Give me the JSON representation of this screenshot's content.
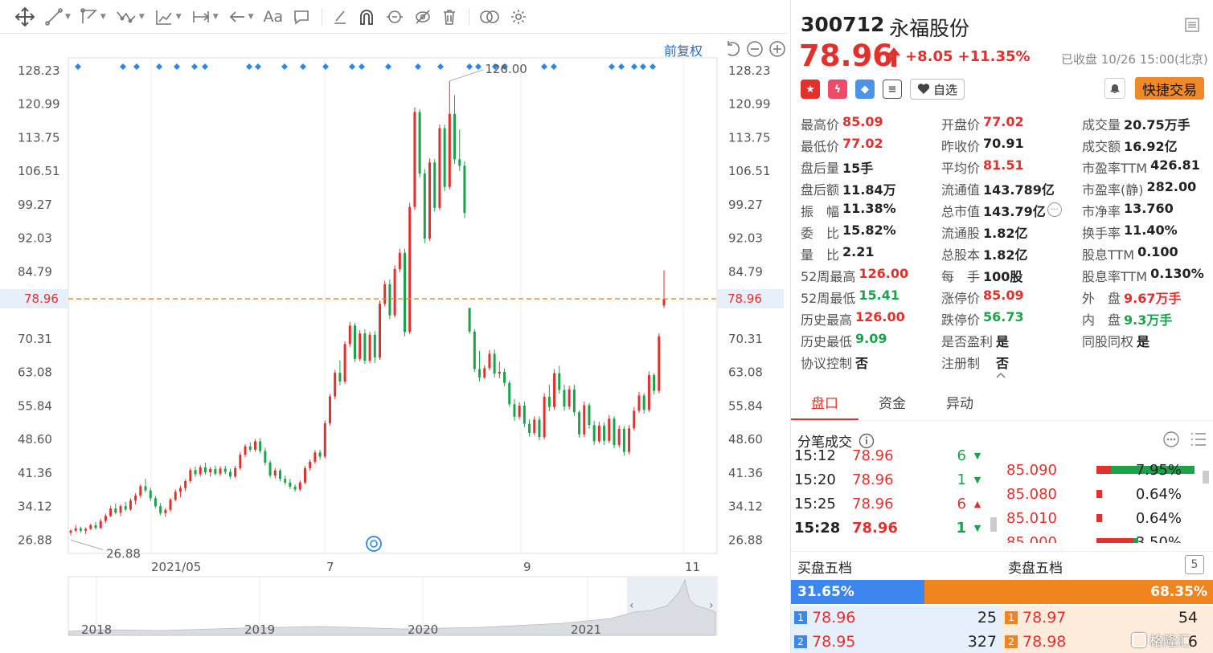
{
  "toolbar": {
    "tools": [
      "move-icon",
      "line-icon",
      "polyline-icon",
      "wave-icon",
      "measure-icon",
      "range-icon",
      "back-arrow-icon",
      "text-tool-icon",
      "comment-icon",
      "pen-icon",
      "magnet-icon",
      "lock-icon",
      "hide-icon",
      "delete-icon",
      "compare-icon",
      "settings-icon"
    ],
    "text_tool_label": "Aa"
  },
  "chart": {
    "fuquan_label": "前复权",
    "current_price_label": "78.96",
    "annotations": {
      "high": "126.00",
      "low": "26.88"
    }
  },
  "chart_data": {
    "type": "candlestick",
    "title": "",
    "xlabel": "",
    "ylabel": "",
    "y_ticks": [
      "128.23",
      "120.99",
      "113.75",
      "106.51",
      "99.27",
      "92.03",
      "84.79",
      "70.31",
      "63.08",
      "55.84",
      "48.60",
      "41.36",
      "34.12",
      "26.88"
    ],
    "x_ticks": [
      "2021/05",
      "7",
      "9",
      "11"
    ],
    "ylim": [
      24.0,
      131.0
    ],
    "current_price": 78.96,
    "high_marker": 126.0,
    "low_marker": 26.88,
    "overview_x_ticks": [
      "2018",
      "2019",
      "2020",
      "2021"
    ],
    "candles": [
      [
        28.5,
        29.2,
        27.9,
        28.9
      ],
      [
        28.9,
        30.1,
        28.6,
        29.4
      ],
      [
        29.4,
        29.8,
        28.5,
        28.9
      ],
      [
        28.9,
        29.6,
        28.2,
        29.3
      ],
      [
        29.3,
        30.4,
        29.0,
        30.1
      ],
      [
        30.1,
        30.8,
        29.1,
        29.5
      ],
      [
        29.5,
        31.5,
        29.3,
        31.0
      ],
      [
        31.0,
        32.6,
        30.5,
        32.1
      ],
      [
        32.1,
        34.3,
        31.8,
        33.7
      ],
      [
        33.7,
        34.8,
        32.4,
        32.8
      ],
      [
        32.8,
        34.6,
        32.0,
        34.2
      ],
      [
        34.2,
        35.1,
        33.1,
        33.5
      ],
      [
        33.5,
        35.9,
        33.2,
        35.4
      ],
      [
        35.4,
        37.0,
        34.6,
        36.5
      ],
      [
        36.5,
        38.9,
        36.0,
        38.5
      ],
      [
        38.5,
        40.1,
        37.2,
        37.6
      ],
      [
        37.6,
        38.2,
        35.3,
        35.9
      ],
      [
        35.9,
        36.4,
        33.8,
        34.2
      ],
      [
        34.2,
        34.9,
        32.2,
        32.7
      ],
      [
        32.7,
        33.8,
        31.9,
        33.4
      ],
      [
        33.4,
        36.0,
        33.0,
        35.6
      ],
      [
        35.6,
        37.8,
        35.2,
        37.3
      ],
      [
        37.3,
        38.6,
        36.1,
        38.1
      ],
      [
        38.1,
        40.0,
        37.5,
        39.6
      ],
      [
        39.6,
        42.4,
        39.2,
        42.0
      ],
      [
        42.0,
        42.8,
        40.5,
        41.1
      ],
      [
        41.1,
        43.1,
        40.6,
        42.6
      ],
      [
        42.6,
        43.6,
        41.0,
        41.5
      ],
      [
        41.5,
        42.7,
        40.6,
        42.2
      ],
      [
        42.2,
        43.0,
        40.8,
        41.2
      ],
      [
        41.2,
        42.8,
        40.7,
        42.3
      ],
      [
        42.3,
        42.9,
        41.1,
        41.6
      ],
      [
        41.6,
        42.3,
        40.1,
        40.6
      ],
      [
        40.6,
        42.9,
        40.2,
        42.4
      ],
      [
        42.4,
        45.9,
        42.0,
        45.3
      ],
      [
        45.3,
        47.6,
        44.8,
        47.1
      ],
      [
        47.1,
        48.0,
        45.9,
        46.4
      ],
      [
        46.4,
        48.7,
        45.9,
        48.2
      ],
      [
        48.2,
        48.9,
        45.6,
        46.1
      ],
      [
        46.1,
        46.8,
        43.0,
        43.6
      ],
      [
        43.6,
        44.1,
        40.3,
        40.8
      ],
      [
        40.8,
        42.4,
        40.2,
        41.9
      ],
      [
        41.9,
        42.3,
        39.6,
        40.1
      ],
      [
        40.1,
        40.8,
        38.8,
        39.3
      ],
      [
        39.3,
        40.1,
        37.9,
        38.4
      ],
      [
        38.4,
        38.9,
        37.3,
        37.8
      ],
      [
        37.8,
        39.8,
        37.4,
        39.3
      ],
      [
        39.3,
        42.9,
        38.9,
        42.4
      ],
      [
        42.4,
        44.3,
        41.8,
        43.8
      ],
      [
        43.8,
        46.3,
        43.3,
        45.8
      ],
      [
        45.8,
        46.4,
        44.2,
        44.9
      ],
      [
        44.9,
        52.7,
        44.5,
        52.1
      ],
      [
        52.1,
        58.4,
        51.6,
        57.9
      ],
      [
        57.9,
        63.6,
        57.3,
        63.0
      ],
      [
        63.0,
        65.7,
        60.3,
        61.1
      ],
      [
        61.1,
        69.8,
        60.6,
        69.2
      ],
      [
        69.2,
        74.0,
        68.5,
        73.2
      ],
      [
        73.2,
        73.8,
        65.3,
        66.0
      ],
      [
        66.0,
        72.2,
        65.5,
        71.5
      ],
      [
        71.5,
        72.4,
        64.9,
        65.6
      ],
      [
        65.6,
        71.9,
        65.1,
        71.2
      ],
      [
        71.2,
        72.0,
        65.1,
        66.3
      ],
      [
        66.3,
        78.6,
        65.8,
        77.9
      ],
      [
        77.9,
        82.9,
        77.4,
        82.1
      ],
      [
        82.1,
        83.1,
        74.6,
        75.4
      ],
      [
        75.4,
        86.2,
        74.9,
        85.4
      ],
      [
        85.4,
        89.8,
        84.7,
        88.9
      ],
      [
        88.9,
        89.8,
        70.9,
        71.8
      ],
      [
        71.8,
        99.7,
        71.3,
        98.8
      ],
      [
        98.8,
        120.3,
        98.2,
        119.3
      ],
      [
        119.3,
        119.9,
        105.2,
        106.0
      ],
      [
        106.0,
        107.0,
        91.0,
        92.0
      ],
      [
        92.0,
        109.3,
        91.5,
        108.4
      ],
      [
        108.4,
        109.1,
        97.8,
        98.6
      ],
      [
        98.6,
        116.6,
        98.1,
        115.8
      ],
      [
        115.8,
        116.6,
        102.2,
        103.1
      ],
      [
        103.1,
        126.0,
        102.6,
        118.9
      ],
      [
        118.9,
        122.9,
        108.1,
        109.1
      ],
      [
        109.1,
        115.5,
        106.6,
        107.7
      ],
      [
        107.7,
        108.7,
        96.4,
        97.5
      ],
      [
        77.0,
        72.0,
        71.4,
        71.9
      ],
      [
        71.9,
        72.4,
        63.2,
        63.8
      ],
      [
        63.8,
        67.7,
        61.1,
        62.0
      ],
      [
        62.0,
        64.6,
        61.6,
        64.0
      ],
      [
        64.0,
        67.9,
        63.5,
        67.1
      ],
      [
        67.1,
        68.0,
        62.0,
        62.8
      ],
      [
        62.8,
        65.4,
        61.8,
        63.2
      ],
      [
        63.2,
        63.9,
        60.1,
        60.8
      ],
      [
        60.8,
        61.3,
        55.6,
        56.2
      ],
      [
        56.2,
        57.3,
        52.6,
        53.5
      ],
      [
        53.5,
        56.6,
        52.9,
        55.9
      ],
      [
        55.9,
        56.8,
        51.2,
        52.0
      ],
      [
        52.0,
        52.9,
        49.2,
        50.0
      ],
      [
        50.0,
        53.6,
        49.5,
        52.9
      ],
      [
        52.9,
        53.6,
        48.4,
        49.1
      ],
      [
        49.1,
        58.6,
        48.6,
        57.8
      ],
      [
        57.8,
        60.4,
        54.7,
        55.6
      ],
      [
        55.6,
        63.8,
        55.0,
        62.9
      ],
      [
        62.9,
        64.5,
        58.5,
        59.3
      ],
      [
        59.3,
        60.4,
        54.8,
        55.7
      ],
      [
        55.7,
        60.2,
        55.1,
        59.4
      ],
      [
        59.4,
        60.4,
        53.7,
        54.5
      ],
      [
        54.5,
        54.9,
        49.0,
        49.7
      ],
      [
        49.7,
        56.8,
        49.1,
        56.0
      ],
      [
        56.0,
        56.5,
        50.9,
        51.7
      ],
      [
        51.7,
        52.6,
        47.4,
        48.2
      ],
      [
        48.2,
        52.4,
        47.7,
        51.6
      ],
      [
        51.6,
        52.3,
        47.4,
        48.3
      ],
      [
        48.3,
        53.9,
        47.8,
        53.1
      ],
      [
        53.1,
        53.6,
        46.7,
        47.4
      ],
      [
        47.4,
        51.6,
        46.9,
        50.9
      ],
      [
        50.9,
        51.5,
        45.1,
        45.9
      ],
      [
        45.9,
        51.7,
        45.4,
        51.0
      ],
      [
        51.0,
        55.6,
        50.5,
        54.8
      ],
      [
        54.8,
        58.9,
        54.3,
        58.1
      ],
      [
        58.1,
        58.6,
        54.2,
        55.0
      ],
      [
        55.0,
        63.3,
        54.5,
        62.5
      ],
      [
        62.5,
        62.9,
        58.3,
        59.1
      ],
      [
        59.1,
        71.5,
        58.6,
        70.9
      ],
      [
        77.5,
        85.1,
        77.0,
        78.96
      ]
    ]
  },
  "stock": {
    "code": "300712",
    "name": "永福股份",
    "price": "78.96",
    "change": "+8.05",
    "change_pct": "+11.35%",
    "status": "已收盘 10/26 15:00(北京)",
    "zixuan_label": "自选",
    "trade_label": "快捷交易"
  },
  "stats": [
    [
      {
        "l": "最高价",
        "v": "85.09",
        "c": "red"
      },
      {
        "l": "开盘价",
        "v": "77.02",
        "c": "red"
      },
      {
        "l": "成交量",
        "v": "20.75万手",
        "c": ""
      }
    ],
    [
      {
        "l": "最低价",
        "v": "77.02",
        "c": "red"
      },
      {
        "l": "昨收价",
        "v": "70.91",
        "c": ""
      },
      {
        "l": "成交额",
        "v": "16.92亿",
        "c": ""
      }
    ],
    [
      {
        "l": "盘后量",
        "v": "15手",
        "c": ""
      },
      {
        "l": "平均价",
        "v": "81.51",
        "c": "red"
      },
      {
        "l": "市盈率TTM",
        "v": "426.81",
        "c": ""
      }
    ],
    [
      {
        "l": "盘后额",
        "v": "11.84万",
        "c": ""
      },
      {
        "l": "流通值",
        "v": "143.789亿",
        "c": ""
      },
      {
        "l": "市盈率(静)",
        "v": "282.00",
        "c": ""
      }
    ],
    [
      {
        "l": "振　幅",
        "v": "11.38%",
        "c": ""
      },
      {
        "l": "总市值",
        "v": "143.79亿",
        "c": ""
      },
      {
        "l": "市净率",
        "v": "13.760",
        "c": ""
      }
    ],
    [
      {
        "l": "委　比",
        "v": "15.82%",
        "c": ""
      },
      {
        "l": "流通股",
        "v": "1.82亿",
        "c": ""
      },
      {
        "l": "换手率",
        "v": "11.40%",
        "c": ""
      }
    ],
    [
      {
        "l": "量　比",
        "v": "2.21",
        "c": ""
      },
      {
        "l": "总股本",
        "v": "1.82亿",
        "c": ""
      },
      {
        "l": "股息TTM",
        "v": "0.100",
        "c": ""
      }
    ],
    [
      {
        "l": "52周最高",
        "v": "126.00",
        "c": "red"
      },
      {
        "l": "每　手",
        "v": "100股",
        "c": ""
      },
      {
        "l": "股息率TTM",
        "v": "0.130%",
        "c": ""
      }
    ],
    [
      {
        "l": "52周最低",
        "v": "15.41",
        "c": "green"
      },
      {
        "l": "涨停价",
        "v": "85.09",
        "c": "red"
      },
      {
        "l": "外　盘",
        "v": "9.67万手",
        "c": "red"
      }
    ],
    [
      {
        "l": "历史最高",
        "v": "126.00",
        "c": "red"
      },
      {
        "l": "跌停价",
        "v": "56.73",
        "c": "green"
      },
      {
        "l": "内　盘",
        "v": "9.3万手",
        "c": "green"
      }
    ],
    [
      {
        "l": "历史最低",
        "v": "9.09",
        "c": "green"
      },
      {
        "l": "是否盈利",
        "v": "是",
        "c": ""
      },
      {
        "l": "同股同权",
        "v": "是",
        "c": ""
      }
    ],
    [
      {
        "l": "协议控制",
        "v": "否",
        "c": ""
      },
      {
        "l": "注册制",
        "v": "　否",
        "c": ""
      },
      {
        "l": "",
        "v": "",
        "c": ""
      }
    ]
  ],
  "tabs": [
    "盘口",
    "资金",
    "异动"
  ],
  "ticks": {
    "title": "分笔成交",
    "rows": [
      {
        "t": "15:12",
        "p": "78.96",
        "v": "6",
        "dir": "down"
      },
      {
        "t": "15:20",
        "p": "78.96",
        "v": "1",
        "dir": "down"
      },
      {
        "t": "15:25",
        "p": "78.96",
        "v": "6",
        "dir": "up"
      },
      {
        "t": "15:28",
        "p": "78.96",
        "v": "1",
        "dir": "down"
      }
    ]
  },
  "distribution": [
    {
      "p": "85.090",
      "pct": "7.95%",
      "red": 0.15,
      "green": 0.85
    },
    {
      "p": "85.080",
      "pct": "0.64%",
      "red": 0.06,
      "green": 0.0
    },
    {
      "p": "85.010",
      "pct": "0.64%",
      "red": 0.06,
      "green": 0.0
    },
    {
      "p": "85.000",
      "pct": "3.50%",
      "red": 0.38,
      "green": 0.05
    }
  ],
  "book": {
    "buy_title": "买盘五档",
    "sell_title": "卖盘五档",
    "five_label": "5",
    "buy_ratio": "31.65%",
    "sell_ratio": "68.35%",
    "buy_ratio_value": 0.3165,
    "rows": [
      {
        "bl": "1",
        "bp": "78.96",
        "bv": "25",
        "sl": "1",
        "sp": "78.97",
        "sv": "54"
      },
      {
        "bl": "2",
        "bp": "78.95",
        "bv": "327",
        "sl": "2",
        "sp": "78.98",
        "sv": "6"
      }
    ]
  },
  "watermark": "格隆汇",
  "colors": {
    "up": "#e2302d",
    "down": "#1aa34a",
    "accent": "#f0841f",
    "blue": "#3d86f0"
  }
}
